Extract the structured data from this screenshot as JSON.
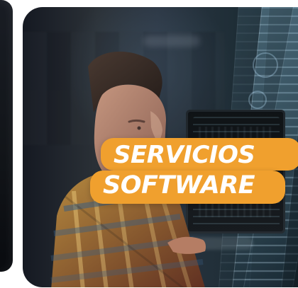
{
  "banner": {
    "line1": "SERVICIOS",
    "line2": "SOFTWARE"
  },
  "image": {
    "subject": "person"
  },
  "colors": {
    "accent": "#f0a02e",
    "text": "#ffffff"
  }
}
